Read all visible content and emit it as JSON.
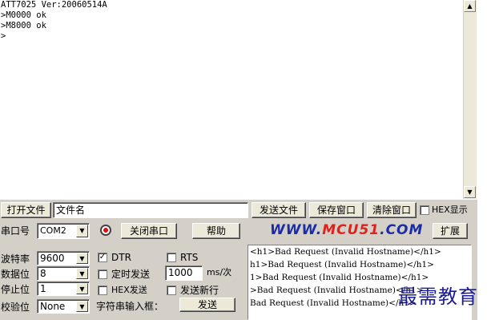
{
  "terminal": {
    "lines": [
      "ATT7025 Ver:20060514A",
      ">M0000 ok",
      ">M8000 ok",
      ">"
    ]
  },
  "row1": {
    "open_file": "打开文件",
    "filename": "文件名",
    "send_file": "发送文件",
    "save_window": "保存窗口",
    "clear_window": "清除窗口",
    "hex_display": "HEX显示"
  },
  "row2": {
    "port_label": "串口号",
    "port_value": "COM2",
    "close_port": "关闭串口",
    "help": "帮助",
    "brand_prefix": "WWW.",
    "brand_mid": "MCU51",
    "brand_suffix": ".COM",
    "expand": "扩展"
  },
  "settings": {
    "baud_label": "波特率",
    "baud_value": "9600",
    "databits_label": "数据位",
    "databits_value": "8",
    "stopbits_label": "停止位",
    "stopbits_value": "1",
    "parity_label": "校验位",
    "parity_value": "None",
    "dtr": "DTR",
    "rts": "RTS",
    "timed_send": "定时发送",
    "interval": "1000",
    "interval_unit": "ms/次",
    "hex_send": "HEX发送",
    "send_newline": "发送新行",
    "input_label": "字符串输入框：",
    "send": "发送"
  },
  "receive": {
    "lines": [
      "<h1>Bad Request (Invalid Hostname)</h1>",
      "h1>Bad Request (Invalid Hostname)</h1>",
      "1>Bad Request (Invalid Hostname)</h1>",
      ">Bad Request (Invalid Hostname)</h1>",
      "Bad Request (Invalid Hostname)</h1>"
    ]
  },
  "watermark": "最需教育",
  "colors": {
    "panel_bg": "#d4d0c8",
    "brand_blue": "#1b2ca8",
    "brand_red": "#e0201a",
    "watermark": "#1a1a9a"
  }
}
